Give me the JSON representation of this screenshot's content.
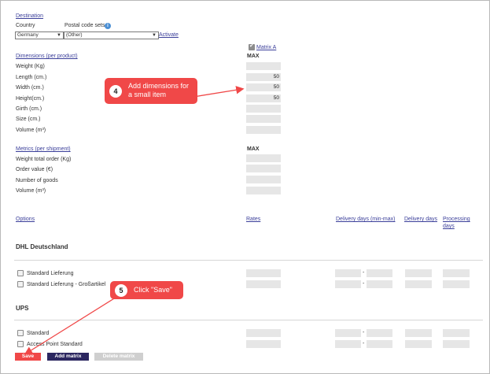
{
  "destination": {
    "heading": "Destination",
    "country_label": "Country",
    "postal_label": "Postal code sets",
    "country_value": "Germany",
    "postal_value": "(Other)",
    "activate_link": "Activate"
  },
  "matrix": {
    "checkbox_label": "Matrix A"
  },
  "dimensions": {
    "heading": "Dimensions (per product)",
    "max_label": "MAX",
    "rows": [
      {
        "label": "Weight (Kg)",
        "value": ""
      },
      {
        "label": "Length (cm.)",
        "value": "50"
      },
      {
        "label": "Width (cm.)",
        "value": "50"
      },
      {
        "label": "Height(cm.)",
        "value": "50"
      },
      {
        "label": "Girth (cm.)",
        "value": ""
      },
      {
        "label": "Size (cm.)",
        "value": ""
      },
      {
        "label": "Volume (m³)",
        "value": ""
      }
    ]
  },
  "metrics": {
    "heading": "Metrics (per shipment)",
    "max_label": "MAX",
    "rows": [
      {
        "label": "Weight total order (Kg)",
        "value": ""
      },
      {
        "label": "Order value (€)",
        "value": ""
      },
      {
        "label": "Number of goods",
        "value": ""
      },
      {
        "label": "Volume (m³)",
        "value": ""
      }
    ]
  },
  "options": {
    "header": {
      "options": "Options",
      "rates": "Rates",
      "delivery_min_max": "Delivery days (min-max)",
      "delivery_days": "Delivery days",
      "processing_line1": "Processing",
      "processing_line2": "days"
    },
    "carriers": [
      {
        "name": "DHL Deutschland",
        "services": [
          "Standard Lieferung",
          "Standard Lieferung - Großartikel"
        ]
      },
      {
        "name": "UPS",
        "services": [
          "Standard",
          "Access Point Standard"
        ]
      }
    ],
    "dash": "-"
  },
  "buttons": {
    "save": "Save",
    "add_matrix": "Add matrix",
    "delete_matrix": "Delete matrix"
  },
  "annotations": {
    "step4_number": "4",
    "step4_line1": "Add dimensions for",
    "step4_line2": "a small item",
    "step5_number": "5",
    "step5_text": "Click \"Save\""
  },
  "colors": {
    "callout": "#f04848",
    "save_button": "#f04848",
    "add_matrix_button": "#2b2660",
    "delete_matrix_button": "#cfcfcf",
    "link": "#3b3f9a"
  }
}
